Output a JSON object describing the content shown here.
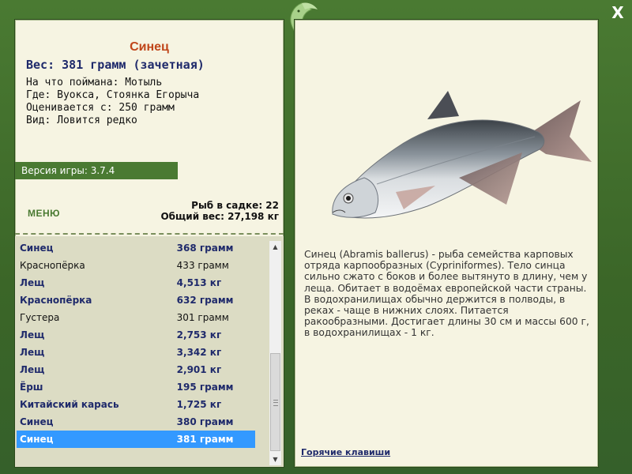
{
  "close_label": "X",
  "left": {
    "title": "Синец",
    "weight_line": "Вес: 381 грамм (зачетная)",
    "info": [
      "На что поймана: Мотыль",
      "Где: Вуокса, Стоянка Егорыча",
      "Оценивается с: 250 грамм",
      "Вид: Ловится редко"
    ],
    "version": "Версия игры: 3.7.4",
    "menu_label": "МЕНЮ",
    "fish_in_keep": "Рыб в садке: 22",
    "total_weight": "Общий вес: 27,198 кг"
  },
  "catch_list": [
    {
      "name": "Синец",
      "weight": "368 грамм",
      "style": "b"
    },
    {
      "name": "Краснопёрка",
      "weight": "433 грамм",
      "style": "n"
    },
    {
      "name": "Лещ",
      "weight": "4,513 кг",
      "style": "b"
    },
    {
      "name": "Краснопёрка",
      "weight": "632 грамм",
      "style": "b"
    },
    {
      "name": "Густера",
      "weight": "301 грамм",
      "style": "n"
    },
    {
      "name": "Лещ",
      "weight": "2,753 кг",
      "style": "b"
    },
    {
      "name": "Лещ",
      "weight": "3,342 кг",
      "style": "b"
    },
    {
      "name": "Лещ",
      "weight": "2,901 кг",
      "style": "b"
    },
    {
      "name": "Ёрш",
      "weight": "195 грамм",
      "style": "b"
    },
    {
      "name": "Китайский карась",
      "weight": "1,725 кг",
      "style": "b"
    },
    {
      "name": "Синец",
      "weight": "380 грамм",
      "style": "b"
    },
    {
      "name": "Синец",
      "weight": "381 грамм",
      "style": "sel"
    }
  ],
  "right": {
    "description": "Синец (Abramis ballerus) - рыба семейства карповых отряда карпообразных (Cypriniformes). Тело синца сильно сжато с боков и более вытянуто в длину, чем у леща. Обитает в водоёмах европейской части страны. В водохранилищах обычно держится в полводы, в реках - чаще в нижних слоях. Питается ракообразными. Достигает длины 30 см и массы 600 г, в водохранилищах - 1 кг.",
    "hotkeys_label": "Горячие клавиши"
  },
  "colors": {
    "frame_green": "#3f6b2d",
    "panel_bg": "#f6f4e2",
    "title_orange": "#c0461a",
    "navy": "#1f2a6b",
    "selection_blue": "#3399ff"
  }
}
